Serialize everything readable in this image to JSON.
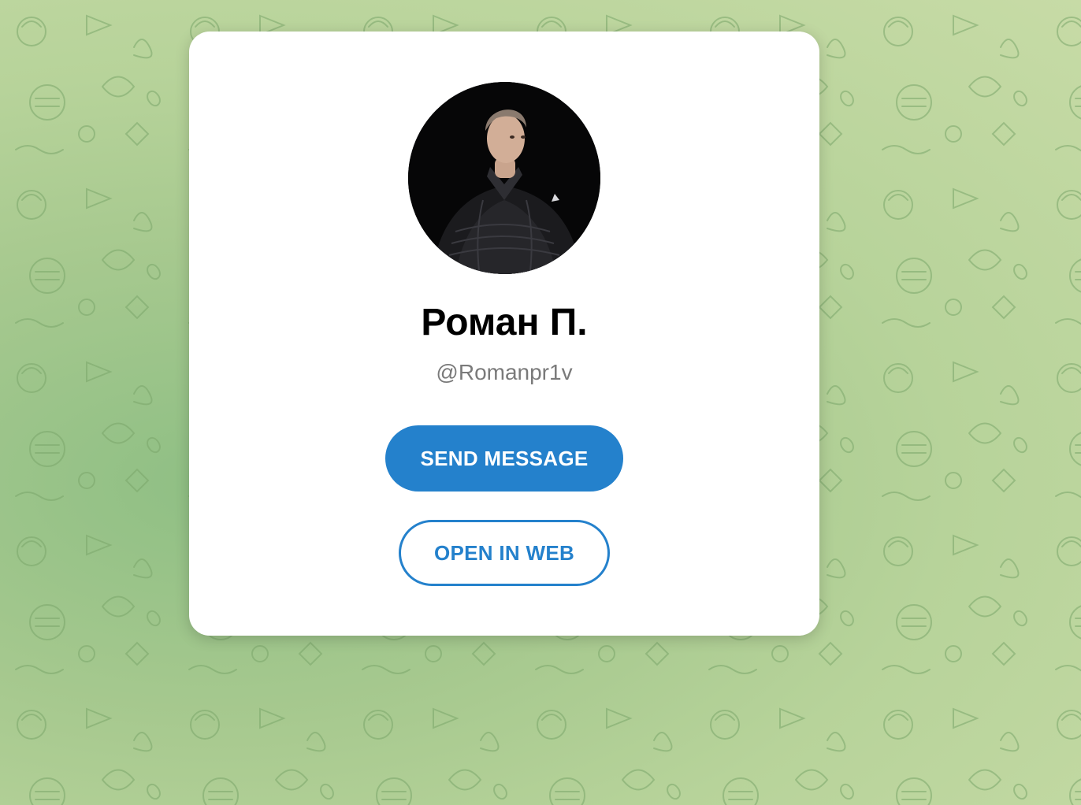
{
  "profile": {
    "name": "Роман П.",
    "username": "@Romanpr1v",
    "avatar_icon": "profile-photo"
  },
  "actions": {
    "send_message_label": "SEND MESSAGE",
    "open_in_web_label": "OPEN IN WEB"
  },
  "colors": {
    "accent": "#2481cc",
    "background_green": "#b7d39a",
    "card": "#ffffff"
  }
}
